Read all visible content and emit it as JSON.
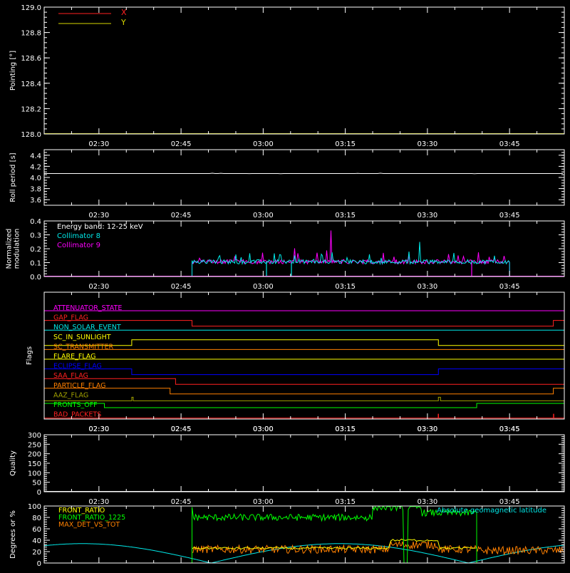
{
  "x_ticks": [
    "02:30",
    "02:45",
    "03:00",
    "03:15",
    "03:30",
    "03:45"
  ],
  "colors": {
    "background": "#000000",
    "axis": "#ffffff",
    "red": "#ff2020",
    "yellow": "#d8d800",
    "cyan": "#00e8e8",
    "magenta": "#ff00ff",
    "orange": "#ff8000",
    "green": "#00ff00",
    "blue": "#0000ff",
    "olive": "#a0a000",
    "gray": "#808080"
  },
  "chart_data": [
    {
      "type": "line",
      "id": "pointing",
      "ylabel": "Pointing [°]",
      "ylim": [
        128.0,
        129.0
      ],
      "yticks": [
        "129.0",
        "128.8",
        "128.6",
        "128.4",
        "128.2",
        "128.0"
      ],
      "series": [
        {
          "name": "X",
          "color": "#ff2020"
        },
        {
          "name": "Y",
          "color": "#d8d800"
        }
      ]
    },
    {
      "type": "line",
      "id": "roll",
      "ylabel": "Roll period [s]",
      "ylim": [
        3.5,
        4.5
      ],
      "yticks": [
        "4.4",
        "4.2",
        "4.0",
        "3.8",
        "3.6"
      ],
      "series": [
        {
          "value": 4.07,
          "color": "#ffffff"
        }
      ]
    },
    {
      "type": "line",
      "id": "modulation",
      "ylabel": [
        "Normalized",
        "modulation"
      ],
      "ylim": [
        0.0,
        0.4
      ],
      "yticks": [
        "0.4",
        "0.3",
        "0.2",
        "0.1",
        "0.0"
      ],
      "legend": [
        "Energy band: 12-25 keV",
        "Collimator 8",
        "Collimator 9"
      ],
      "series": [
        {
          "name": "Collimator 8",
          "color": "#00e8e8",
          "x_start": "02:47",
          "x_end": "03:45",
          "baseline": 0.1
        },
        {
          "name": "Collimator 9",
          "color": "#ff00ff",
          "x_start": "02:47",
          "x_end": "03:45",
          "baseline": 0.1
        }
      ]
    },
    {
      "type": "line",
      "id": "flags",
      "ylabel": "Flags",
      "flags": [
        {
          "name": "ATTENUATOR_STATE",
          "color": "#ff00ff"
        },
        {
          "name": "GAP_FLAG",
          "color": "#ff2020"
        },
        {
          "name": "NON_SOLAR_EVENT",
          "color": "#00e8e8"
        },
        {
          "name": "SC_IN_SUNLIGHT",
          "color": "#ffff00"
        },
        {
          "name": "SC_TRANSMITTER",
          "color": "#ff8000"
        },
        {
          "name": "FLARE_FLAG",
          "color": "#ffff00"
        },
        {
          "name": "ECLIPSE_FLAG",
          "color": "#0000ff"
        },
        {
          "name": "SAA_FLAG",
          "color": "#ff2020"
        },
        {
          "name": "PARTICLE_FLAG",
          "color": "#ff8000"
        },
        {
          "name": "AAZ_FLAG",
          "color": "#a0a000"
        },
        {
          "name": "FRONTS_OFF",
          "color": "#00ff00"
        },
        {
          "name": "BAD_PACKETS",
          "color": "#ff2020"
        }
      ]
    },
    {
      "type": "line",
      "id": "quality",
      "ylabel": "Quality",
      "ylim": [
        0,
        300
      ],
      "yticks": [
        "300",
        "250",
        "200",
        "150",
        "100",
        "50",
        "0"
      ],
      "series": []
    },
    {
      "type": "line",
      "id": "ratios",
      "ylabel": "Degrees or %",
      "ylim": [
        0,
        100
      ],
      "yticks": [
        "100",
        "80",
        "60",
        "40",
        "20",
        "0"
      ],
      "series": [
        {
          "name": "FRONT_RATIO",
          "color": "#ffff00"
        },
        {
          "name": "FRONT_RATIO_1225",
          "color": "#00ff00"
        },
        {
          "name": "MAX_DET_VS_TOT",
          "color": "#ff8000"
        },
        {
          "name": "Absolute geomagnetic latitude",
          "color": "#00e8e8"
        }
      ]
    }
  ]
}
